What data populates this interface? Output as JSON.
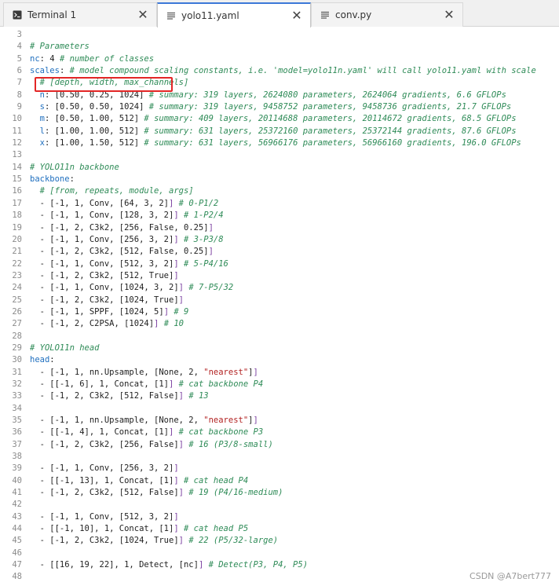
{
  "tabs": [
    {
      "label": "Terminal 1",
      "icon": "terminal-icon",
      "close": "✕"
    },
    {
      "label": "yolo11.yaml",
      "icon": "file-text-icon",
      "close": "✕",
      "active": true
    },
    {
      "label": "conv.py",
      "icon": "file-text-icon",
      "close": "✕"
    }
  ],
  "lines": [
    {
      "n": "3",
      "parts": []
    },
    {
      "n": "4",
      "parts": [
        {
          "t": "# Parameters",
          "c": "c"
        }
      ]
    },
    {
      "n": "5",
      "parts": [
        {
          "t": "nc",
          "c": "k"
        },
        {
          "t": ": 4 "
        },
        {
          "t": "# number of classes",
          "c": "c"
        }
      ]
    },
    {
      "n": "6",
      "parts": [
        {
          "t": "scales",
          "c": "k"
        },
        {
          "t": ": "
        },
        {
          "t": "# model compound scaling constants, i.e. 'model=yolo11n.yaml' will call yolo11.yaml with scale",
          "c": "c"
        }
      ]
    },
    {
      "n": "7",
      "parts": [
        {
          "t": "  "
        },
        {
          "t": "# [depth, width, max_channels]",
          "c": "c"
        }
      ]
    },
    {
      "n": "8",
      "parts": [
        {
          "t": "  "
        },
        {
          "t": "n",
          "c": "k"
        },
        {
          "t": ": [0.50, 0.25, 1024] "
        },
        {
          "t": "# summary: 319 layers, 2624080 parameters, 2624064 gradients, 6.6 GFLOPs",
          "c": "c"
        }
      ]
    },
    {
      "n": "9",
      "parts": [
        {
          "t": "  "
        },
        {
          "t": "s",
          "c": "k"
        },
        {
          "t": ": [0.50, 0.50, 1024] "
        },
        {
          "t": "# summary: 319 layers, 9458752 parameters, 9458736 gradients, 21.7 GFLOPs",
          "c": "c"
        }
      ]
    },
    {
      "n": "10",
      "parts": [
        {
          "t": "  "
        },
        {
          "t": "m",
          "c": "k"
        },
        {
          "t": ": [0.50, 1.00, 512] "
        },
        {
          "t": "# summary: 409 layers, 20114688 parameters, 20114672 gradients, 68.5 GFLOPs",
          "c": "c"
        }
      ]
    },
    {
      "n": "11",
      "parts": [
        {
          "t": "  "
        },
        {
          "t": "l",
          "c": "k"
        },
        {
          "t": ": [1.00, 1.00, 512] "
        },
        {
          "t": "# summary: 631 layers, 25372160 parameters, 25372144 gradients, 87.6 GFLOPs",
          "c": "c"
        }
      ]
    },
    {
      "n": "12",
      "parts": [
        {
          "t": "  "
        },
        {
          "t": "x",
          "c": "k"
        },
        {
          "t": ": [1.00, 1.50, 512] "
        },
        {
          "t": "# summary: 631 layers, 56966176 parameters, 56966160 gradients, 196.0 GFLOPs",
          "c": "c"
        }
      ]
    },
    {
      "n": "13",
      "parts": []
    },
    {
      "n": "14",
      "parts": [
        {
          "t": "# YOLO11n backbone",
          "c": "c"
        }
      ]
    },
    {
      "n": "15",
      "parts": [
        {
          "t": "backbone",
          "c": "k"
        },
        {
          "t": ":"
        }
      ]
    },
    {
      "n": "16",
      "parts": [
        {
          "t": "  "
        },
        {
          "t": "# [from, repeats, module, args]",
          "c": "c"
        }
      ]
    },
    {
      "n": "17",
      "parts": [
        {
          "t": "  - [-1, 1, Conv, [64, 3, 2]"
        },
        {
          "t": "]",
          "c": "b"
        },
        {
          "t": " "
        },
        {
          "t": "# 0-P1/2",
          "c": "c"
        }
      ]
    },
    {
      "n": "18",
      "parts": [
        {
          "t": "  - [-1, 1, Conv, [128, 3, 2]"
        },
        {
          "t": "]",
          "c": "b"
        },
        {
          "t": " "
        },
        {
          "t": "# 1-P2/4",
          "c": "c"
        }
      ]
    },
    {
      "n": "19",
      "parts": [
        {
          "t": "  - [-1, 2, C3k2, [256, False, 0.25]"
        },
        {
          "t": "]",
          "c": "b"
        }
      ]
    },
    {
      "n": "20",
      "parts": [
        {
          "t": "  - [-1, 1, Conv, [256, 3, 2]"
        },
        {
          "t": "]",
          "c": "b"
        },
        {
          "t": " "
        },
        {
          "t": "# 3-P3/8",
          "c": "c"
        }
      ]
    },
    {
      "n": "21",
      "parts": [
        {
          "t": "  - [-1, 2, C3k2, [512, False, 0.25]"
        },
        {
          "t": "]",
          "c": "b"
        }
      ]
    },
    {
      "n": "22",
      "parts": [
        {
          "t": "  - [-1, 1, Conv, [512, 3, 2]"
        },
        {
          "t": "]",
          "c": "b"
        },
        {
          "t": " "
        },
        {
          "t": "# 5-P4/16",
          "c": "c"
        }
      ]
    },
    {
      "n": "23",
      "parts": [
        {
          "t": "  - [-1, 2, C3k2, [512, True]"
        },
        {
          "t": "]",
          "c": "b"
        }
      ]
    },
    {
      "n": "24",
      "parts": [
        {
          "t": "  - [-1, 1, Conv, [1024, 3, 2]"
        },
        {
          "t": "]",
          "c": "b"
        },
        {
          "t": " "
        },
        {
          "t": "# 7-P5/32",
          "c": "c"
        }
      ]
    },
    {
      "n": "25",
      "parts": [
        {
          "t": "  - [-1, 2, C3k2, [1024, True]"
        },
        {
          "t": "]",
          "c": "b"
        }
      ]
    },
    {
      "n": "26",
      "parts": [
        {
          "t": "  - [-1, 1, SPPF, [1024, 5]"
        },
        {
          "t": "]",
          "c": "b"
        },
        {
          "t": " "
        },
        {
          "t": "# 9",
          "c": "c"
        }
      ]
    },
    {
      "n": "27",
      "parts": [
        {
          "t": "  - [-1, 2, C2PSA, [1024]"
        },
        {
          "t": "]",
          "c": "b"
        },
        {
          "t": " "
        },
        {
          "t": "# 10",
          "c": "c"
        }
      ]
    },
    {
      "n": "28",
      "parts": []
    },
    {
      "n": "29",
      "parts": [
        {
          "t": "# YOLO11n head",
          "c": "c"
        }
      ]
    },
    {
      "n": "30",
      "parts": [
        {
          "t": "head",
          "c": "k"
        },
        {
          "t": ":"
        }
      ]
    },
    {
      "n": "31",
      "parts": [
        {
          "t": "  - [-1, 1, nn.Upsample, [None, 2, "
        },
        {
          "t": "\"nearest\"",
          "c": "s"
        },
        {
          "t": "]"
        },
        {
          "t": "]",
          "c": "b"
        }
      ]
    },
    {
      "n": "32",
      "parts": [
        {
          "t": "  - [[-1, 6], 1, Concat, [1]"
        },
        {
          "t": "]",
          "c": "b"
        },
        {
          "t": " "
        },
        {
          "t": "# cat backbone P4",
          "c": "c"
        }
      ]
    },
    {
      "n": "33",
      "parts": [
        {
          "t": "  - [-1, 2, C3k2, [512, False]"
        },
        {
          "t": "]",
          "c": "b"
        },
        {
          "t": " "
        },
        {
          "t": "# 13",
          "c": "c"
        }
      ]
    },
    {
      "n": "34",
      "parts": []
    },
    {
      "n": "35",
      "parts": [
        {
          "t": "  - [-1, 1, nn.Upsample, [None, 2, "
        },
        {
          "t": "\"nearest\"",
          "c": "s"
        },
        {
          "t": "]"
        },
        {
          "t": "]",
          "c": "b"
        }
      ]
    },
    {
      "n": "36",
      "parts": [
        {
          "t": "  - [[-1, 4], 1, Concat, [1]"
        },
        {
          "t": "]",
          "c": "b"
        },
        {
          "t": " "
        },
        {
          "t": "# cat backbone P3",
          "c": "c"
        }
      ]
    },
    {
      "n": "37",
      "parts": [
        {
          "t": "  - [-1, 2, C3k2, [256, False]"
        },
        {
          "t": "]",
          "c": "b"
        },
        {
          "t": " "
        },
        {
          "t": "# 16 (P3/8-small)",
          "c": "c"
        }
      ]
    },
    {
      "n": "38",
      "parts": []
    },
    {
      "n": "39",
      "parts": [
        {
          "t": "  - [-1, 1, Conv, [256, 3, 2]"
        },
        {
          "t": "]",
          "c": "b"
        }
      ]
    },
    {
      "n": "40",
      "parts": [
        {
          "t": "  - [[-1, 13], 1, Concat, [1]"
        },
        {
          "t": "]",
          "c": "b"
        },
        {
          "t": " "
        },
        {
          "t": "# cat head P4",
          "c": "c"
        }
      ]
    },
    {
      "n": "41",
      "parts": [
        {
          "t": "  - [-1, 2, C3k2, [512, False]"
        },
        {
          "t": "]",
          "c": "b"
        },
        {
          "t": " "
        },
        {
          "t": "# 19 (P4/16-medium)",
          "c": "c"
        }
      ]
    },
    {
      "n": "42",
      "parts": []
    },
    {
      "n": "43",
      "parts": [
        {
          "t": "  - [-1, 1, Conv, [512, 3, 2]"
        },
        {
          "t": "]",
          "c": "b"
        }
      ]
    },
    {
      "n": "44",
      "parts": [
        {
          "t": "  - [[-1, 10], 1, Concat, [1]"
        },
        {
          "t": "]",
          "c": "b"
        },
        {
          "t": " "
        },
        {
          "t": "# cat head P5",
          "c": "c"
        }
      ]
    },
    {
      "n": "45",
      "parts": [
        {
          "t": "  - [-1, 2, C3k2, [1024, True]"
        },
        {
          "t": "]",
          "c": "b"
        },
        {
          "t": " "
        },
        {
          "t": "# 22 (P5/32-large)",
          "c": "c"
        }
      ]
    },
    {
      "n": "46",
      "parts": []
    },
    {
      "n": "47",
      "parts": [
        {
          "t": "  - [[16, 19, 22], 1, Detect, [nc]"
        },
        {
          "t": "]",
          "c": "b"
        },
        {
          "t": " "
        },
        {
          "t": "# Detect(P3, P4, P5)",
          "c": "c"
        }
      ]
    },
    {
      "n": "48",
      "parts": []
    }
  ],
  "watermark": "CSDN @A7bert777",
  "colors": {
    "comment": "#2e8b57",
    "key": "#1f6fbf",
    "string": "#b22222",
    "highlight_box": "#e32626",
    "active_tab_accent": "#3c78d8"
  }
}
